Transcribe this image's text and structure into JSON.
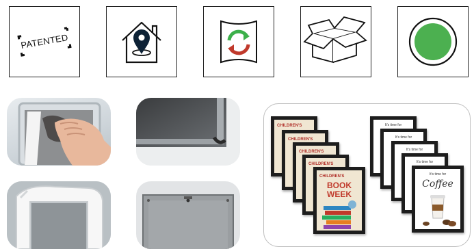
{
  "icons": {
    "patented_label": "PATENTED"
  },
  "posters": {
    "book": {
      "line1": "CHILDREN'S",
      "line2": "BOOK",
      "line3": "WEEK"
    },
    "coffee": {
      "line1": "It's time for",
      "line2": "Coffee"
    }
  },
  "colors": {
    "pin": "#0d2236",
    "arrow_green": "#3cb04a",
    "arrow_red": "#c0392b",
    "dot_green": "#4cb050"
  }
}
